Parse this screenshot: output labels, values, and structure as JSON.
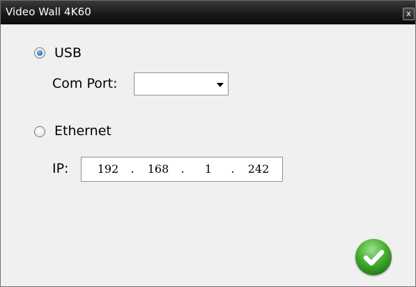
{
  "window": {
    "title": "Video Wall 4K60",
    "close_glyph": "x"
  },
  "connection": {
    "usb": {
      "label": "USB",
      "selected": true
    },
    "com_port": {
      "label": "Com Port:",
      "value": ""
    },
    "ethernet": {
      "label": "Ethernet",
      "selected": false
    },
    "ip": {
      "label": "IP:",
      "octets": [
        "192",
        "168",
        "1",
        "242"
      ],
      "separator": "."
    }
  },
  "ok_button": {
    "icon": "checkmark-icon",
    "color": "#3aa12c"
  }
}
